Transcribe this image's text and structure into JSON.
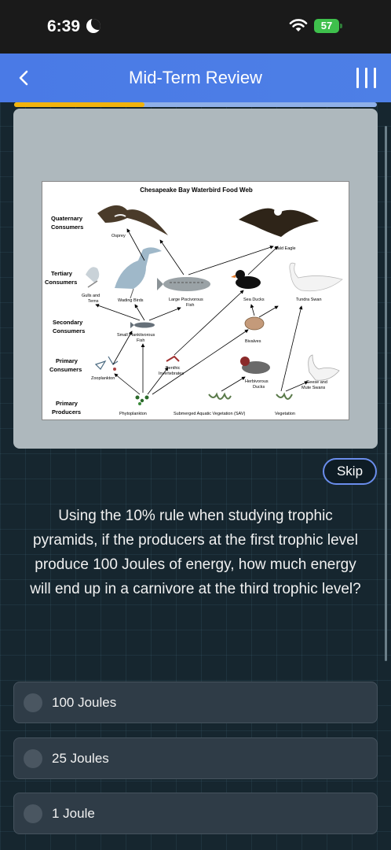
{
  "status_bar": {
    "time": "6:39",
    "battery": "57"
  },
  "header": {
    "title": "Mid-Term Review"
  },
  "progress": {
    "fraction": 0.36
  },
  "food_web": {
    "title": "Chesapeake Bay Waterbird Food Web",
    "levels": [
      [
        "Quaternary",
        "Consumers"
      ],
      [
        "Tertiary",
        "Consumers"
      ],
      [
        "Secondary",
        "Consumers"
      ],
      [
        "Primary",
        "Consumers"
      ],
      [
        "Primary",
        "Producers"
      ]
    ],
    "organisms": {
      "osprey": "Osprey",
      "bald_eagle": "Bald Eagle",
      "gulls": [
        "Gulls and",
        "Terns"
      ],
      "wading_birds": "Wading Birds",
      "piscivorous": [
        "Large Piscivorous",
        "Fish"
      ],
      "sea_ducks": "Sea Ducks",
      "tundra_swan": "Tundra Swan",
      "planktivorous": [
        "Small Planktivorous",
        "Fish"
      ],
      "bivalves": "Bivalves",
      "benthic": [
        "Benthic",
        "Invertebrates"
      ],
      "zooplankton": "Zooplankton",
      "herbivorous": [
        "Herbivorous",
        "Ducks"
      ],
      "geese": [
        "Geese and",
        "Mute Swans"
      ],
      "phytoplankton": "Phytoplankton",
      "sav": "Submerged Aquatic Vegetation (SAV)",
      "vegetation": "Vegetation"
    }
  },
  "skip_label": "Skip",
  "question": "Using the 10% rule when studying trophic pyramids, if the producers at the first trophic level produce 100 Joules of energy, how much energy will end up in a carnivore at the third trophic level?",
  "options": [
    {
      "label": "100 Joules"
    },
    {
      "label": "25 Joules"
    },
    {
      "label": "1 Joule"
    }
  ]
}
